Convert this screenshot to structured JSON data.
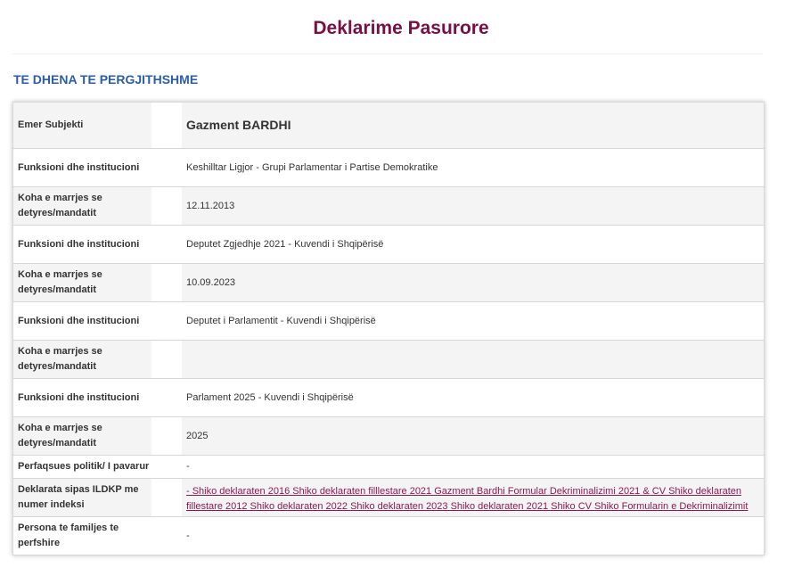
{
  "page_title": "Deklarime Pasurore",
  "section_heading": "TE DHENA TE PERGJITHSHME",
  "rows": [
    {
      "label": "Emer Subjekti",
      "value": "Gazment BARDHI"
    },
    {
      "label": "Funksioni dhe institucioni",
      "value": "Keshilltar Ligjor - Grupi Parlamentar i Partise Demokratike"
    },
    {
      "label": "Koha e marrjes se detyres/mandatit",
      "value": "12.11.2013"
    },
    {
      "label": "Funksioni dhe institucioni",
      "value": "Deputet Zgjedhje 2021 - Kuvendi i Shqipërisë"
    },
    {
      "label": "Koha e marrjes se detyres/mandatit",
      "value": "10.09.2023"
    },
    {
      "label": "Funksioni dhe institucioni",
      "value": "Deputet i Parlamentit - Kuvendi i Shqipërisë"
    },
    {
      "label": "Koha e marrjes se detyres/mandatit",
      "value": ""
    },
    {
      "label": "Funksioni dhe institucioni",
      "value": "Parlament 2025 - Kuvendi i Shqipërisë"
    },
    {
      "label": "Koha e marrjes se detyres/mandatit",
      "value": "2025"
    },
    {
      "label": "Perfaqsues politik/ I pavarur",
      "value": "-"
    },
    {
      "label": "Deklarata sipas ILDKP me numer indeksi",
      "value": "- Shiko deklaraten 2016 Shiko deklaraten filllestare 2021 Gazment Bardhi Formular Dekriminalizimi 2021 & CV Shiko deklaraten fillestare 2012 Shiko deklaraten 2022 Shiko deklaraten 2023 Shiko deklaraten 2021 Shiko CV Shiko Formularin e Dekriminalizimit"
    },
    {
      "label": "Persona te familjes te perfshire",
      "value": "-"
    }
  ]
}
